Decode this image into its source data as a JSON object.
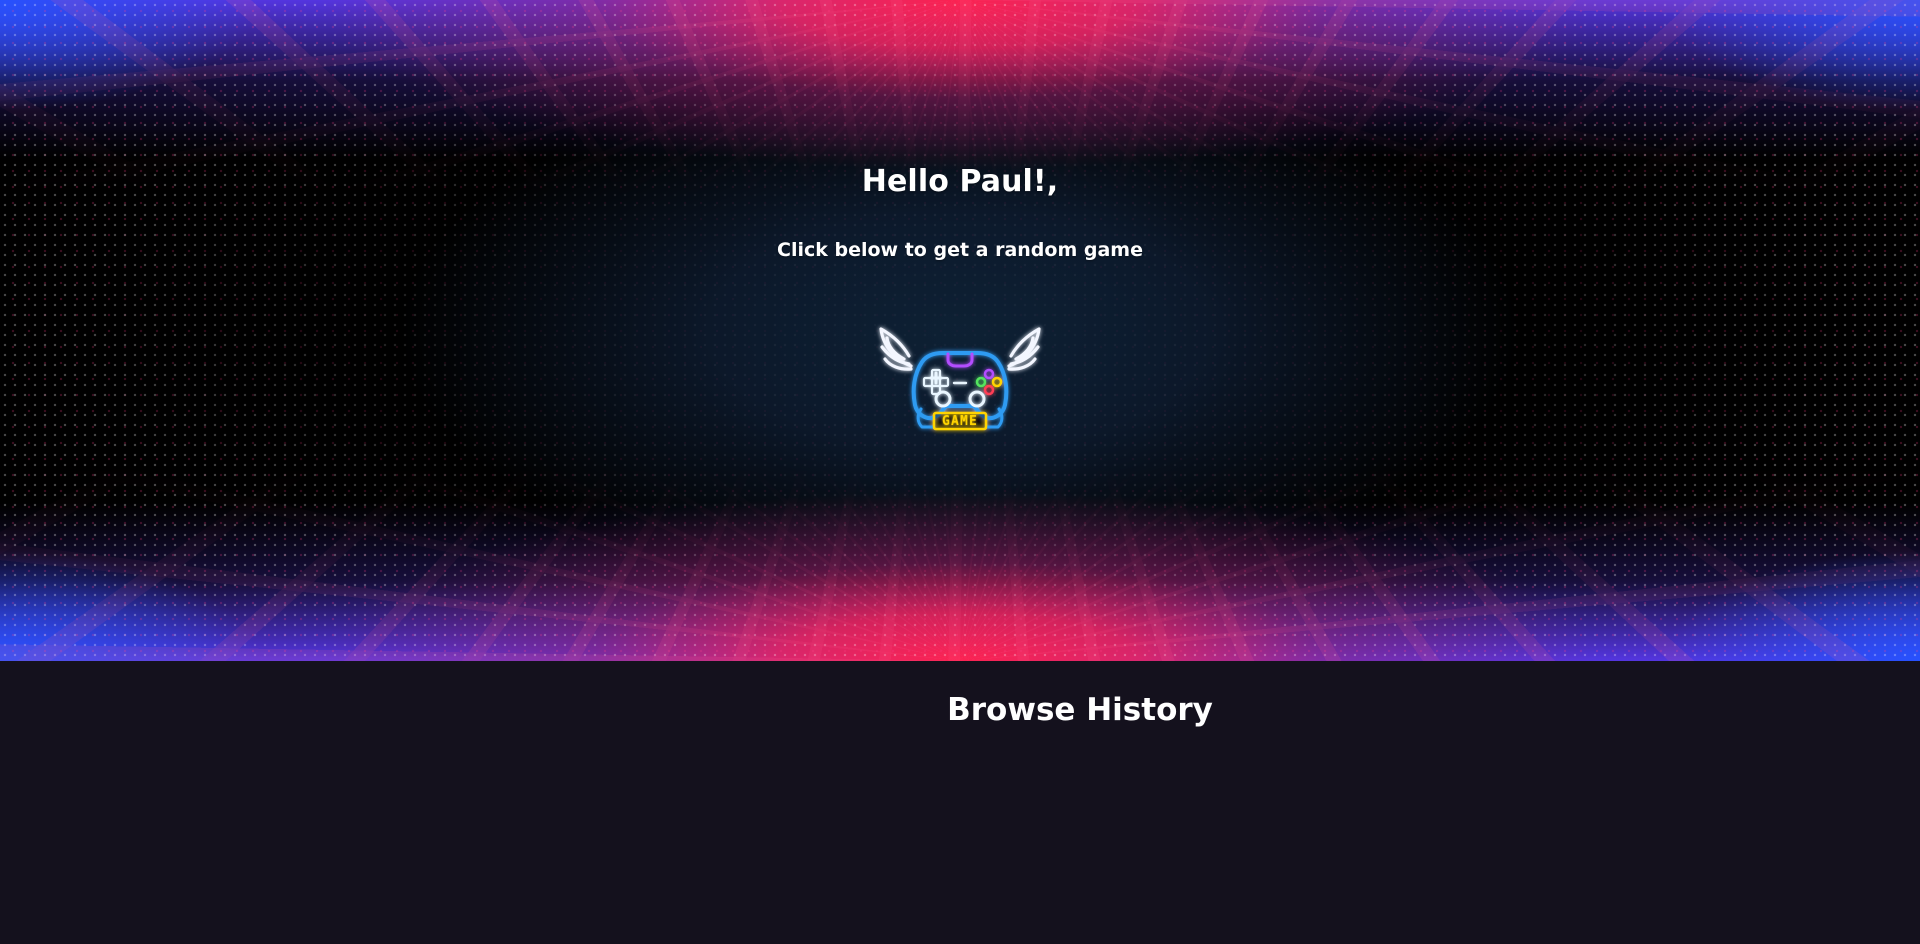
{
  "hero": {
    "greeting": "Hello Paul!,",
    "subtitle": "Click below to get a random game",
    "button_logo_text": "GAME",
    "button_icon": "winged-game-controller-icon"
  },
  "history": {
    "title": "Browse History"
  },
  "colors": {
    "history_background": "#14111d",
    "hero_pink": "#ff224e",
    "hero_blue": "#2453ff",
    "logo_blue": "#2f9bf2",
    "logo_purple": "#b34dff",
    "logo_yellow": "#ffd400"
  }
}
